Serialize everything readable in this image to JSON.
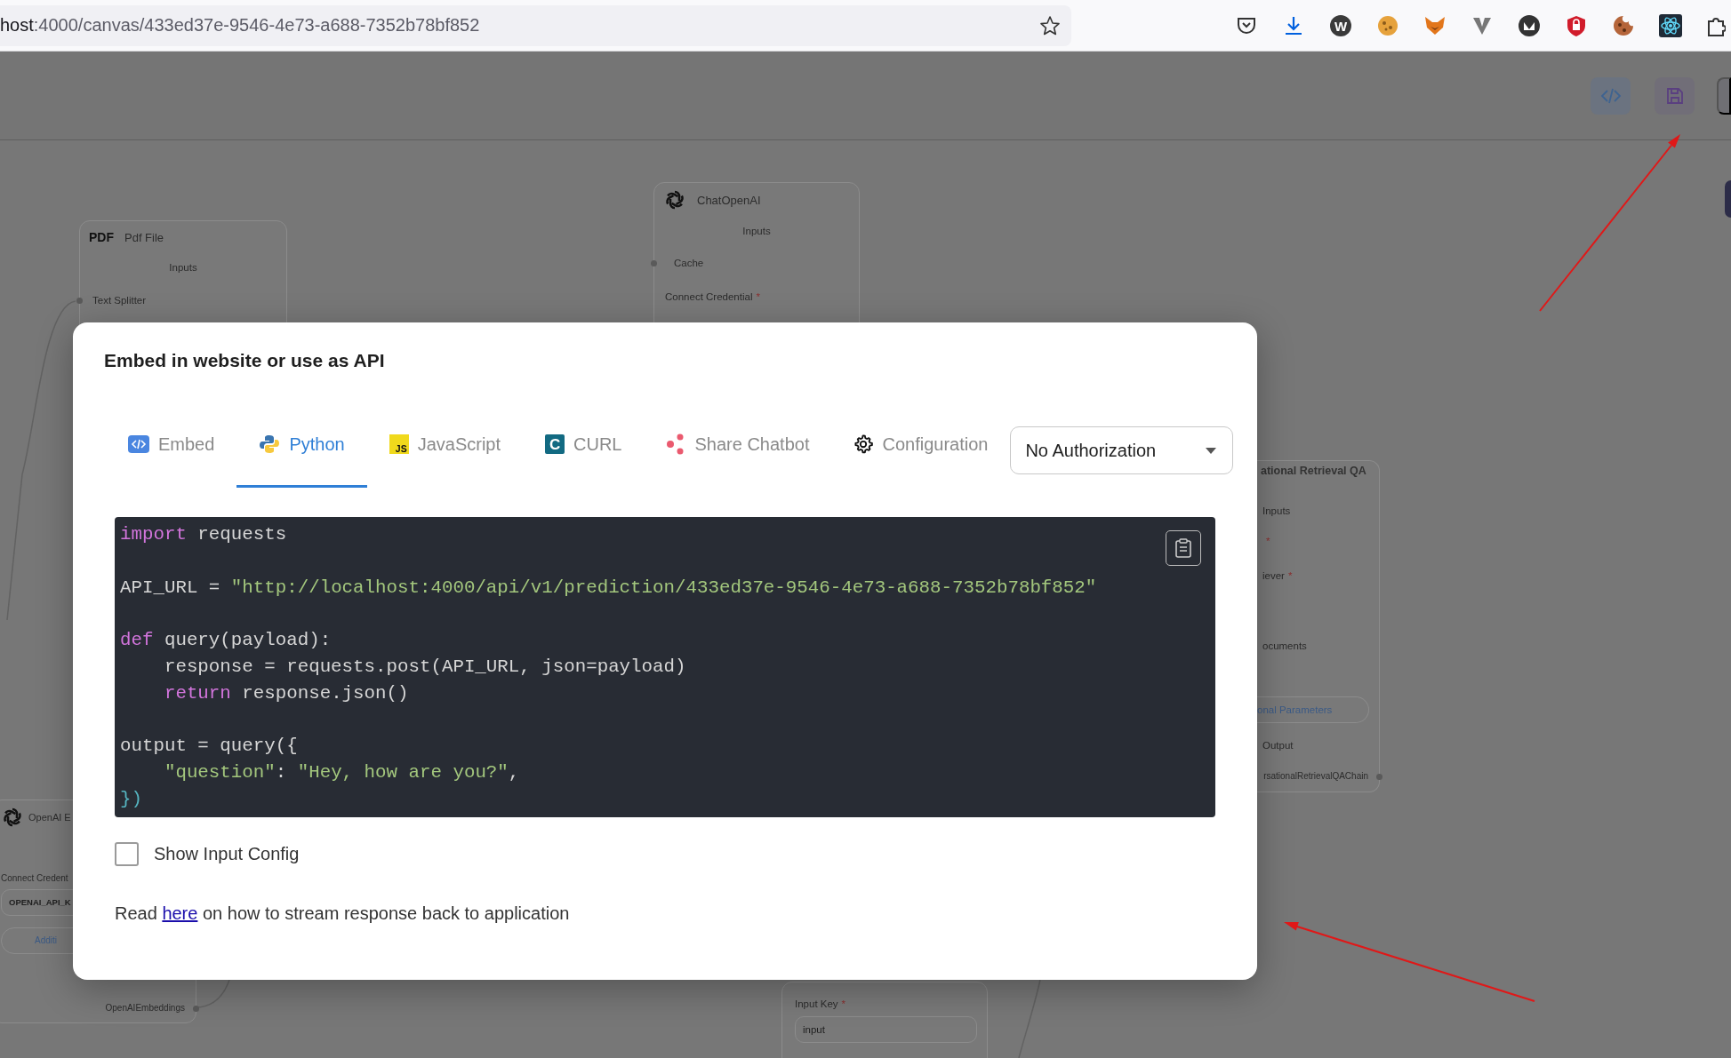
{
  "browser": {
    "url": {
      "host": "host",
      "rest": ":4000/canvas/433ed37e-9546-4e73-a688-7352b78bf852"
    },
    "extensions": [
      {
        "kind": "pocket"
      },
      {
        "kind": "download"
      },
      {
        "kind": "letter",
        "label": "W"
      },
      {
        "kind": "cookie"
      },
      {
        "kind": "fox"
      },
      {
        "kind": "vee"
      },
      {
        "kind": "mask"
      },
      {
        "kind": "shield"
      },
      {
        "kind": "cookie_bite"
      },
      {
        "kind": "atom"
      },
      {
        "kind": "puzzle"
      }
    ]
  },
  "canvas": {
    "header_buttons": [
      {
        "kind": "code"
      },
      {
        "kind": "save"
      }
    ],
    "nodes": [
      {
        "icon": {
          "kind": "text",
          "label": "PDF"
        },
        "title": "Pdf File",
        "rows": [
          {
            "kind": "section",
            "text": "Inputs"
          },
          {
            "kind": "port",
            "text": "Text Splitter"
          }
        ]
      },
      {
        "icon": {
          "kind": "openai"
        },
        "title": "ChatOpenAI",
        "rows": [
          {
            "kind": "section",
            "text": "Inputs"
          },
          {
            "kind": "port",
            "text": "Cache"
          },
          {
            "kind": "label",
            "text": "Connect Credential",
            "mark": "*"
          }
        ]
      },
      {
        "title": "ational Retrieval QA",
        "rows": [
          {
            "kind": "section",
            "text": "Inputs"
          },
          {
            "kind": "label",
            "mark": "*"
          },
          {
            "kind": "label",
            "text": "iever",
            "mark": "*"
          },
          {
            "kind": "label",
            "text": "ocuments"
          },
          {
            "kind": "pill",
            "text": "onal Parameters"
          },
          {
            "kind": "section",
            "text": "Output"
          },
          {
            "kind": "output",
            "text": "rsationalRetrievalQAChain"
          }
        ]
      },
      {
        "icon": {
          "kind": "openai"
        },
        "title": "OpenAI E",
        "rows": [
          {
            "kind": "label",
            "text": "Connect Credent"
          },
          {
            "kind": "field",
            "text": "OPENAI_API_K"
          },
          {
            "kind": "pill",
            "text": "Additi"
          },
          {
            "kind": "output",
            "text": "OpenAIEmbeddings"
          }
        ]
      },
      {
        "rows": [
          {
            "kind": "label",
            "text": "Input Key",
            "mark": "*"
          },
          {
            "kind": "field",
            "text": "input"
          }
        ]
      }
    ]
  },
  "dialog": {
    "title": "Embed in website or use as API",
    "tabs": [
      {
        "label": "Embed",
        "kind": "embed",
        "selected": false
      },
      {
        "label": "Python",
        "kind": "python",
        "selected": true
      },
      {
        "label": "JavaScript",
        "kind": "js",
        "icon_text": "JS",
        "selected": false
      },
      {
        "label": "CURL",
        "kind": "curl",
        "icon_text": "C",
        "selected": false
      },
      {
        "label": "Share Chatbot",
        "kind": "share",
        "selected": false
      },
      {
        "label": "Configuration",
        "kind": "gear",
        "selected": false
      }
    ],
    "authorization": {
      "value": "No Authorization"
    },
    "code_lines": [
      {
        "kind": "code",
        "tokens": [
          {
            "text": "import",
            "kind": "keyword"
          },
          {
            "text": " requests",
            "kind": "plain"
          }
        ]
      },
      {
        "kind": "blank"
      },
      {
        "kind": "code",
        "tokens": [
          {
            "text": "API_URL = ",
            "kind": "plain"
          },
          {
            "text": "\"http://localhost:4000/api/v1/prediction/433ed37e-9546-4e73-a688-7352b78bf852\"",
            "kind": "string"
          }
        ]
      },
      {
        "kind": "blank"
      },
      {
        "kind": "code",
        "tokens": [
          {
            "text": "def",
            "kind": "keyword"
          },
          {
            "text": " query(payload):",
            "kind": "plain"
          }
        ]
      },
      {
        "kind": "code",
        "tokens": [
          {
            "text": "    response = requests.post(API_URL, json=payload)",
            "kind": "plain"
          }
        ]
      },
      {
        "kind": "code",
        "tokens": [
          {
            "text": "    return",
            "kind": "keyword"
          },
          {
            "text": " response.json()",
            "kind": "plain"
          }
        ]
      },
      {
        "kind": "blank"
      },
      {
        "kind": "code",
        "tokens": [
          {
            "text": "output = query({",
            "kind": "plain"
          }
        ]
      },
      {
        "kind": "code",
        "tokens": [
          {
            "text": "    \"question\"",
            "kind": "string"
          },
          {
            "text": ": ",
            "kind": "plain"
          },
          {
            "text": "\"Hey, how are you?\"",
            "kind": "string"
          },
          {
            "text": ",",
            "kind": "plain"
          }
        ]
      },
      {
        "kind": "code",
        "tokens": [
          {
            "text": "})",
            "kind": "punct"
          }
        ]
      }
    ],
    "show_input_config": {
      "label": "Show Input Config",
      "checked": false
    },
    "stream_note": {
      "before": "Read ",
      "link": "here",
      "after": " on how to stream response back to application"
    }
  }
}
